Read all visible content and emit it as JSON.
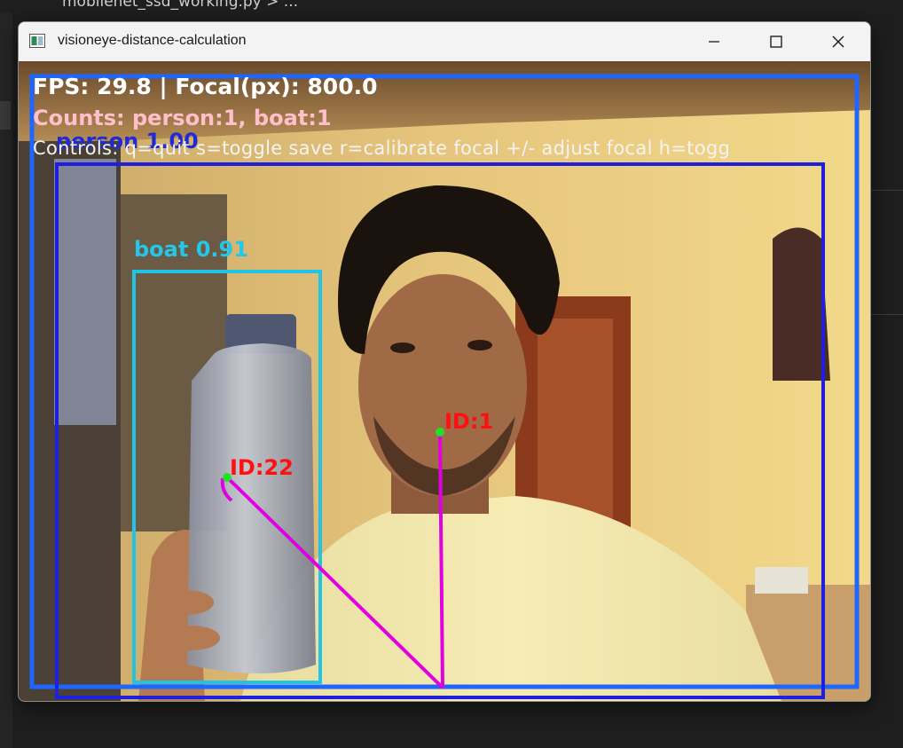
{
  "ide": {
    "tab_label": "mobilenet_ssd_working.py > ..."
  },
  "window": {
    "title": "visioneye-distance-calculation",
    "controls": [
      "minimize",
      "maximize",
      "close"
    ]
  },
  "overlay": {
    "fps_text": "FPS: 29.8 | Focal(px): 800.0",
    "counts_text": "Counts: person:1, boat:1",
    "controls_text": "Controls: q=quit  s=toggle save  r=calibrate focal  +/- adjust focal  h=togg"
  },
  "detections": [
    {
      "label": "person 1.00",
      "class": "person",
      "confidence": 1.0,
      "box_color": "#1f1fe0"
    },
    {
      "label": "boat 0.91",
      "class": "boat",
      "confidence": 0.91,
      "box_color": "#22c4e6"
    }
  ],
  "tracks": [
    {
      "label": "ID:1",
      "color": "#ff1010"
    },
    {
      "label": "ID:22",
      "color": "#ff1010"
    }
  ],
  "colors": {
    "outer_box": "#1f66ff",
    "vision_line": "#e000e0",
    "center_point": "#22e02a"
  }
}
